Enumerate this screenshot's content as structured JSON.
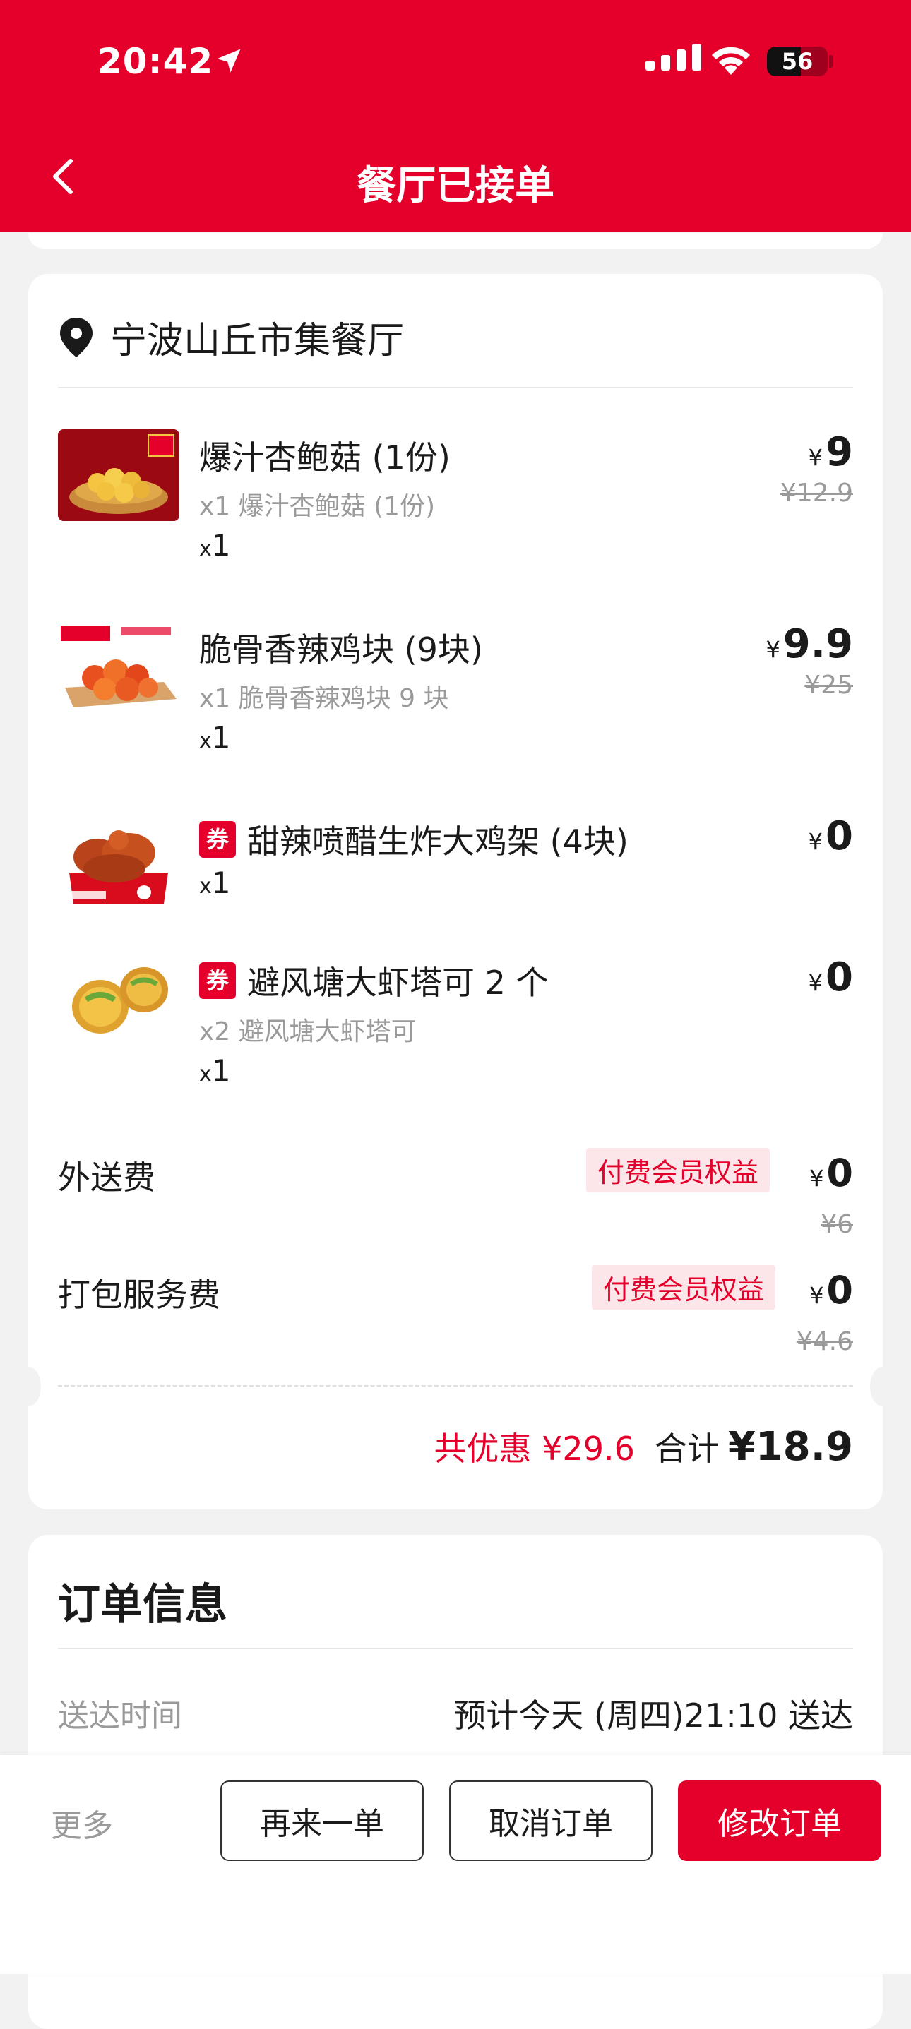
{
  "status_bar": {
    "time": "20:42",
    "battery": "56",
    "battery_level": 0.56
  },
  "header": {
    "title": "餐厅已接单"
  },
  "store": {
    "name": "宁波山丘市集餐厅"
  },
  "items": [
    {
      "name": "爆汁杏鲍菇 (1份)",
      "detail": "x1 爆汁杏鲍菇 (1份)",
      "qty_prefix": "x",
      "qty": "1",
      "currency": "¥",
      "price": "9",
      "original_price": "¥12.9",
      "coupon": ""
    },
    {
      "name": "脆骨香辣鸡块 (9块)",
      "detail": "x1 脆骨香辣鸡块 9 块",
      "qty_prefix": "x",
      "qty": "1",
      "currency": "¥",
      "price": "9.9",
      "original_price": "¥25",
      "coupon": ""
    },
    {
      "name": "甜辣喷醋生炸大鸡架 (4块)",
      "detail": "",
      "qty_prefix": "x",
      "qty": "1",
      "currency": "¥",
      "price": "0",
      "original_price": "",
      "coupon": "券"
    },
    {
      "name": "避风塘大虾塔可 2 个",
      "detail": "x2 避风塘大虾塔可",
      "qty_prefix": "x",
      "qty": "1",
      "currency": "¥",
      "price": "0",
      "original_price": "",
      "coupon": "券"
    }
  ],
  "fees": [
    {
      "label": "外送费",
      "badge": "付费会员权益",
      "currency": "¥",
      "price": "0",
      "original_price": "¥6"
    },
    {
      "label": "打包服务费",
      "badge": "付费会员权益",
      "currency": "¥",
      "price": "0",
      "original_price": "¥4.6"
    }
  ],
  "summary": {
    "discount": "共优惠 ¥29.6",
    "total_label": "合计",
    "total": "¥18.9"
  },
  "order_info": {
    "title": "订单信息",
    "delivery_label": "送达时间",
    "delivery_value": "预计今天 (周四)21:10 送达"
  },
  "actions": {
    "more": "更多",
    "reorder": "再来一单",
    "cancel": "取消订单",
    "modify": "修改订单"
  },
  "colors": {
    "brand": "#e4002b",
    "muted": "#9a9a9a",
    "badge_bg": "#fde6e9"
  }
}
